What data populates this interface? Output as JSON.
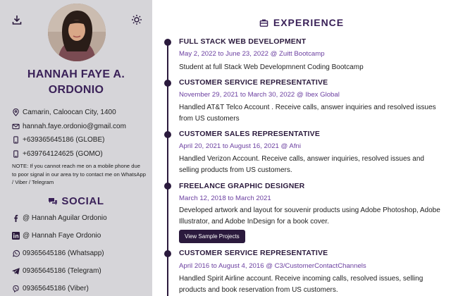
{
  "sidebar": {
    "name_line1": "HANNAH FAYE A.",
    "name_line2": "ORDONIO",
    "contacts": {
      "address": "Camarin, Caloocan City, 1400",
      "email": "hannah.faye.ordonio@gmail.com",
      "phone_globe": "+639365645186 (GLOBE)",
      "phone_gomo": "+639764124625 (GOMO)"
    },
    "note": "NOTE: If you cannot reach me on a mobile phone due to poor signal in our area try to contact me on WhatsApp / Viber / Telegram",
    "social_title": "SOCIAL",
    "socials": {
      "facebook": "@ Hannah Aguilar Ordonio",
      "linkedin": "@ Hannah Faye Ordonio",
      "whatsapp": "09365645186 (Whatsapp)",
      "telegram": "09365645186 (Telegram)",
      "viber": "09365645186 (Viber)"
    }
  },
  "main": {
    "section_title": "EXPERIENCE",
    "jobs": [
      {
        "title": "FULL STACK WEB DEVELOPMENT",
        "date": "May 2, 2022 to June 23, 2022 @ Zuitt Bootcamp",
        "desc": "Student at full Stack Web Developmnent Coding Bootcamp"
      },
      {
        "title": "CUSTOMER SERVICE REPRESENTATIVE",
        "date": "November 29, 2021 to March 30, 2022 @ Ibex Global",
        "desc": "Handled AT&T Telco Account . Receive calls, answer inquiries and resolved issues from US customers"
      },
      {
        "title": "CUSTOMER SALES REPRESENTATIVE",
        "date": "April 20, 2021 to August 16, 2021 @ Afni",
        "desc": "Handled Verizon Account. Receive calls, answer inquiries, resolved issues and selling products from US customers."
      },
      {
        "title": "FREELANCE GRAPHIC DESIGNER",
        "date": "March 12, 2018 to March 2021",
        "desc": "Developed artwork and layout for souvenir products using Adobe Photoshop, Adobe Illustrator, and Adobe InDesign for a book cover.",
        "button": "View Sample Projects"
      },
      {
        "title": "CUSTOMER SERVICE REPRESENTATIVE",
        "date": "April 2016 to August 4, 2016 @ C3/CustomerContactChannels",
        "desc": "Handled Spirit Airline account. Receive incoming calls, resolved issues, selling products and book reservation from US customers."
      }
    ]
  },
  "colors": {
    "sidebar_bg": "#d6d5d9",
    "accent": "#2b1a3d",
    "heading": "#3a2158",
    "date": "#6b3fa0"
  }
}
